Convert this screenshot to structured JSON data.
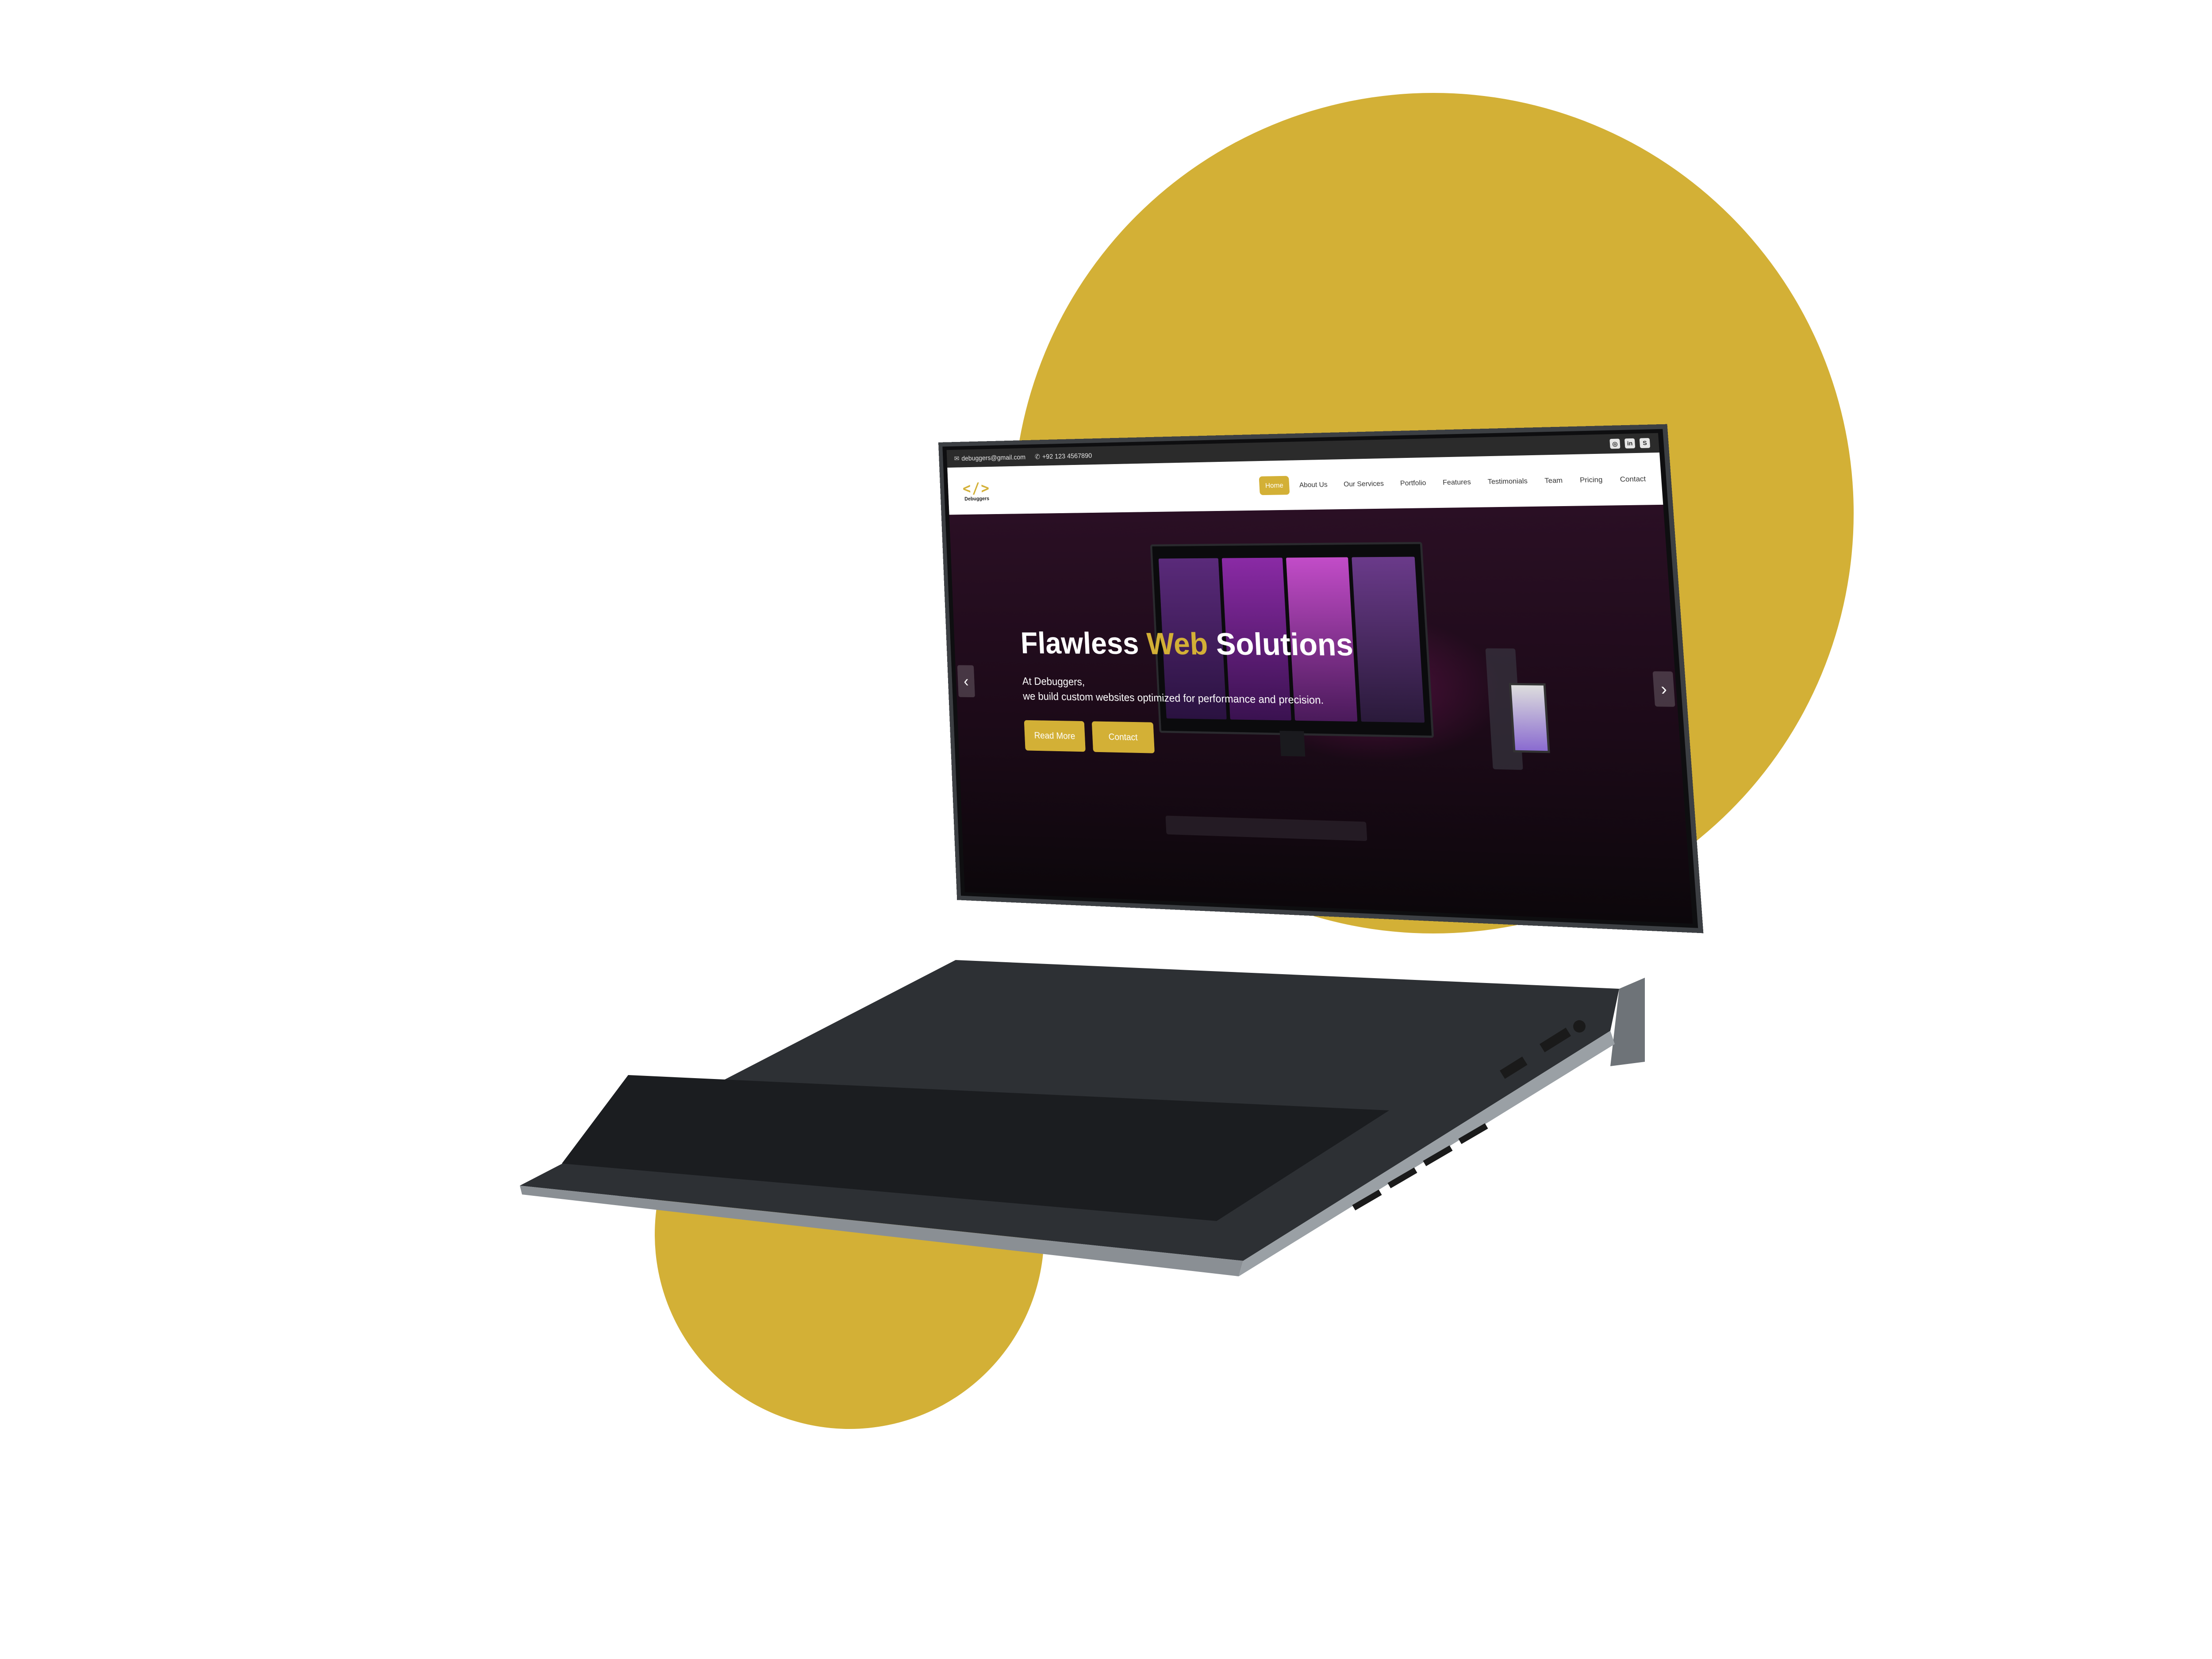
{
  "colors": {
    "accent": "#d3b036",
    "topbar": "#2b2b2b",
    "laptop_body": "#3c3f43"
  },
  "topbar": {
    "email": "debuggers@gmail.com",
    "phone": "+92 123 4567890",
    "email_icon": "mail-icon",
    "phone_icon": "phone-icon",
    "social": [
      {
        "name": "instagram-icon",
        "glyph": "◎"
      },
      {
        "name": "linkedin-icon",
        "glyph": "in"
      },
      {
        "name": "skype-icon",
        "glyph": "S"
      }
    ]
  },
  "logo": {
    "mark": "</>",
    "text": "Debuggers"
  },
  "nav": {
    "items": [
      "Home",
      "About Us",
      "Our Services",
      "Portfolio",
      "Features",
      "Testimonials",
      "Team",
      "Pricing",
      "Contact"
    ],
    "active": "Home"
  },
  "hero": {
    "title_part1": "Flawless ",
    "title_accent": "Web",
    "title_part2": " Solutions",
    "subtitle_line1": "At Debuggers,",
    "subtitle_line2": "we build custom websites optimized for performance and precision.",
    "buttons": {
      "read_more": "Read More",
      "contact": "Contact"
    },
    "arrow_left": "‹",
    "arrow_right": "›"
  }
}
